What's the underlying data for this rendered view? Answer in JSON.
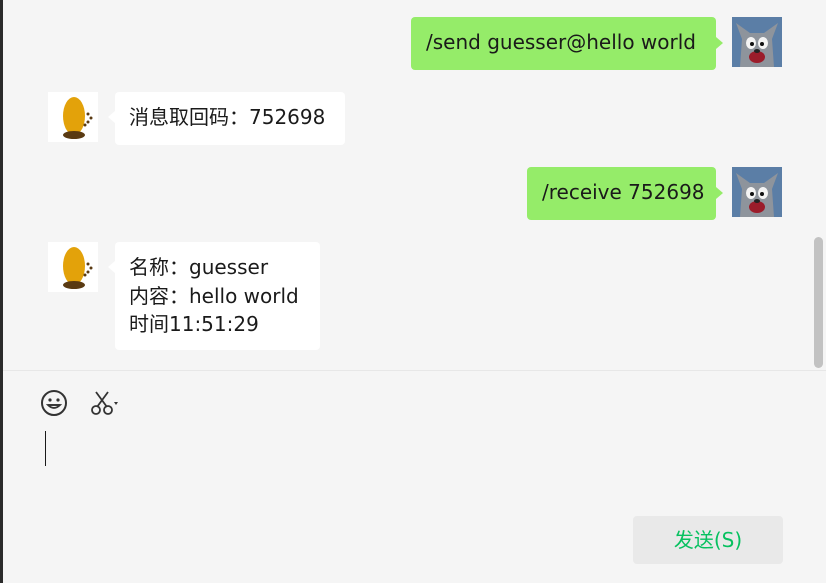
{
  "messages": [
    {
      "side": "right",
      "lines": [
        "/send guesser@hello world"
      ]
    },
    {
      "side": "left",
      "lines": [
        "消息取回码：752698"
      ]
    },
    {
      "side": "right",
      "lines": [
        "/receive 752698"
      ]
    },
    {
      "side": "left",
      "lines": [
        "名称：guesser",
        "内容：hello world",
        "时间11:51:29"
      ]
    }
  ],
  "toolbar": {
    "emoji_icon": "smiley-icon",
    "screenshot_icon": "scissors-icon"
  },
  "input": {
    "value": ""
  },
  "send_button": {
    "label": "发送(S)"
  },
  "colors": {
    "self_bubble": "#95ec69",
    "other_bubble": "#ffffff",
    "send_text": "#07c160"
  }
}
